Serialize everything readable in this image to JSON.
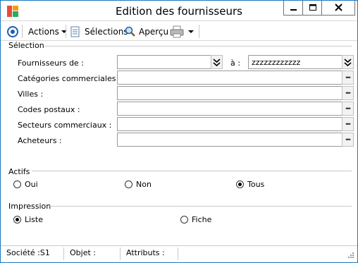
{
  "window": {
    "title": "Edition des fournisseurs"
  },
  "toolbar": {
    "actions_label": "Actions",
    "selections_label": "Sélections",
    "apercu_label": "Aperçu"
  },
  "selection": {
    "heading": "Sélection",
    "fields": [
      {
        "label": "Fournisseurs de :",
        "value": ""
      },
      {
        "label": "Catégories commerciales :",
        "value": ""
      },
      {
        "label": "Villes :",
        "value": ""
      },
      {
        "label": "Codes postaux :",
        "value": ""
      },
      {
        "label": "Secteurs commerciaux :",
        "value": ""
      },
      {
        "label": "Acheteurs :",
        "value": ""
      }
    ],
    "to_label": "à :",
    "to_value": "zzzzzzzzzzzz"
  },
  "actifs": {
    "heading": "Actifs",
    "options": [
      "Oui",
      "Non",
      "Tous"
    ],
    "selected": "Tous"
  },
  "impression": {
    "heading": "Impression",
    "options": [
      "Liste",
      "Fiche"
    ],
    "selected": "Liste"
  },
  "status": {
    "societe": "Société :S1",
    "objet": "Objet :",
    "attributs": "Attributs :"
  },
  "colors": {
    "accent": "#1a78c2",
    "border": "#9a9a9a"
  },
  "icons": [
    "app-icon",
    "minimize-icon",
    "maximize-icon",
    "close-icon",
    "target-icon",
    "chevron-down-icon",
    "document-icon",
    "magnifier-icon",
    "printer-icon",
    "double-chevron-down-icon",
    "ellipsis-icon",
    "resize-grip-icon"
  ]
}
